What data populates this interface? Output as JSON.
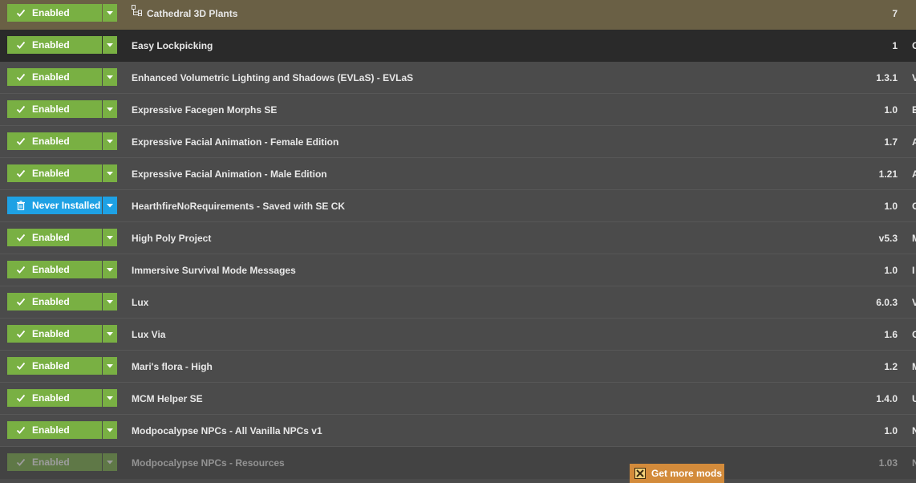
{
  "colors": {
    "enabled": "#79b043",
    "never_installed": "#1ea1e4",
    "get_more": "#d38b3b",
    "highlight_row": "#6a6045",
    "selected_row": "#2a2a2a"
  },
  "mods": [
    {
      "status": "Enabled",
      "status_icon": "check-icon",
      "name": "Cathedral 3D Plants",
      "version": "7",
      "extra": "",
      "row_state": "highlight",
      "name_icon": "file-tree-icon"
    },
    {
      "status": "Enabled",
      "status_icon": "check-icon",
      "name": "Easy Lockpicking",
      "version": "1",
      "extra": "C",
      "row_state": "selected"
    },
    {
      "status": "Enabled",
      "status_icon": "check-icon",
      "name": "Enhanced Volumetric Lighting and Shadows (EVLaS) - EVLaS",
      "version": "1.3.1",
      "extra": "V"
    },
    {
      "status": "Enabled",
      "status_icon": "check-icon",
      "name": "Expressive Facegen Morphs SE",
      "version": "1.0",
      "extra": "E"
    },
    {
      "status": "Enabled",
      "status_icon": "check-icon",
      "name": "Expressive Facial Animation - Female Edition",
      "version": "1.7",
      "extra": "A"
    },
    {
      "status": "Enabled",
      "status_icon": "check-icon",
      "name": "Expressive Facial Animation - Male Edition",
      "version": "1.21",
      "extra": "A"
    },
    {
      "status": "Never Installed",
      "status_icon": "trash-icon",
      "name": "HearthfireNoRequirements - Saved with SE CK",
      "version": "1.0",
      "extra": "C"
    },
    {
      "status": "Enabled",
      "status_icon": "check-icon",
      "name": "High Poly Project",
      "version": "v5.3",
      "extra": "M"
    },
    {
      "status": "Enabled",
      "status_icon": "check-icon",
      "name": "Immersive Survival Mode Messages",
      "version": "1.0",
      "extra": "I"
    },
    {
      "status": "Enabled",
      "status_icon": "check-icon",
      "name": "Lux",
      "version": "6.0.3",
      "extra": "V"
    },
    {
      "status": "Enabled",
      "status_icon": "check-icon",
      "name": "Lux Via",
      "version": "1.6",
      "extra": "C"
    },
    {
      "status": "Enabled",
      "status_icon": "check-icon",
      "name": "Mari's flora - High",
      "version": "1.2",
      "extra": "M"
    },
    {
      "status": "Enabled",
      "status_icon": "check-icon",
      "name": "MCM Helper SE",
      "version": "1.4.0",
      "extra": "U"
    },
    {
      "status": "Enabled",
      "status_icon": "check-icon",
      "name": "Modpocalypse NPCs - All Vanilla NPCs v1",
      "version": "1.0",
      "extra": "N"
    },
    {
      "status": "Enabled",
      "status_icon": "check-icon",
      "name": "Modpocalypse NPCs - Resources",
      "version": "1.03",
      "extra": "N",
      "row_state": "faded"
    }
  ],
  "get_more": {
    "label": "Get more mods",
    "icon": "nexus-logo-icon"
  }
}
